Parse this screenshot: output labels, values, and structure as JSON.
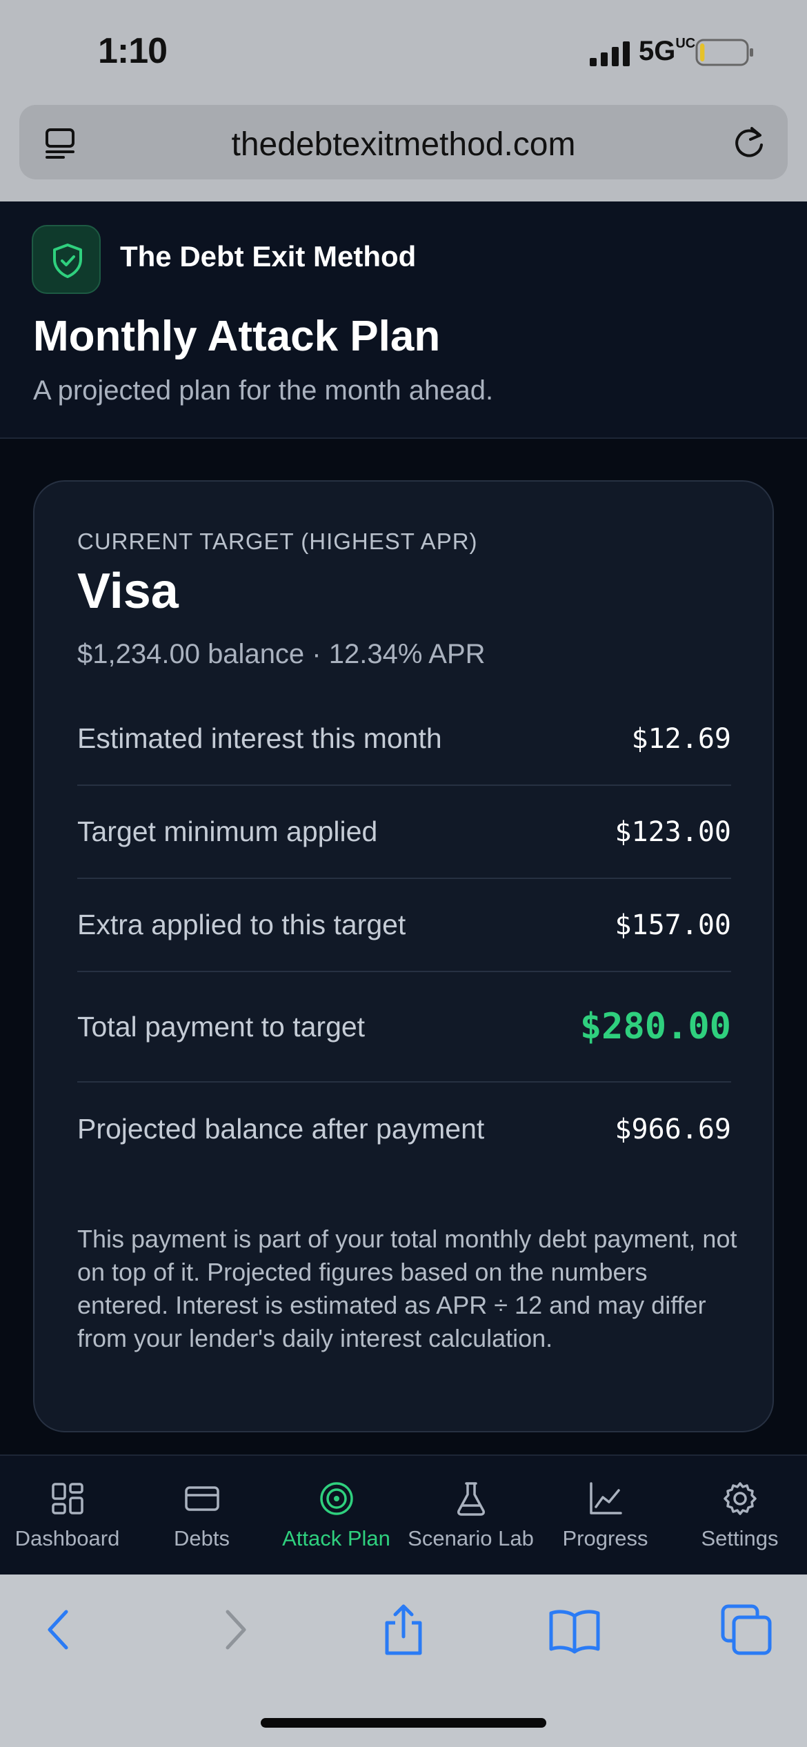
{
  "status_bar": {
    "time": "1:10",
    "network": "5G",
    "network_suffix": "UC",
    "battery_level": 0.1
  },
  "browser": {
    "url": "thedebtexitmethod.com"
  },
  "app": {
    "brand_name": "The Debt Exit Method",
    "page_title": "Monthly Attack Plan",
    "page_subtitle": "A projected plan for the month ahead.",
    "colors": {
      "accent": "#2fd07e",
      "background": "#060b14",
      "card": "#111927"
    }
  },
  "target_card": {
    "label": "CURRENT TARGET (HIGHEST APR)",
    "name": "Visa",
    "meta": "$1,234.00 balance · 12.34% APR",
    "rows": [
      {
        "label": "Estimated interest this month",
        "value": "$12.69"
      },
      {
        "label": "Target minimum applied",
        "value": "$123.00"
      },
      {
        "label": "Extra applied to this target",
        "value": "$157.00"
      },
      {
        "label": "Total payment to target",
        "value": "$280.00"
      },
      {
        "label": "Projected balance after payment",
        "value": "$966.69"
      }
    ],
    "disclaimer": "This payment is part of your total monthly debt payment, not on top of it. Projected figures based on the numbers entered. Interest is estimated as APR ÷ 12 and may differ from your lender's daily interest calculation."
  },
  "tabs": [
    {
      "label": "Dashboard",
      "icon": "dashboard-icon"
    },
    {
      "label": "Debts",
      "icon": "card-icon"
    },
    {
      "label": "Attack Plan",
      "icon": "target-icon",
      "active": true
    },
    {
      "label": "Scenario Lab",
      "icon": "flask-icon"
    },
    {
      "label": "Progress",
      "icon": "chart-icon"
    },
    {
      "label": "Settings",
      "icon": "gear-icon"
    }
  ]
}
